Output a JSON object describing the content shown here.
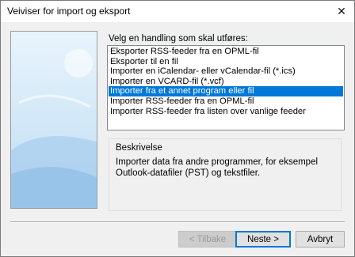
{
  "window": {
    "title": "Veiviser for import og eksport"
  },
  "prompt": "Velg en handling som skal utføres:",
  "actions": [
    {
      "label": "Eksporter RSS-feeder fra en OPML-fil",
      "selected": false
    },
    {
      "label": "Eksporter til en fil",
      "selected": false
    },
    {
      "label": "Importer en iCalendar- eller vCalendar-fil (*.ics)",
      "selected": false
    },
    {
      "label": "Importer en VCARD-fil (*.vcf)",
      "selected": false
    },
    {
      "label": "Importer fra et annet program eller fil",
      "selected": true
    },
    {
      "label": "Importer RSS-feeder fra en OPML-fil",
      "selected": false
    },
    {
      "label": "Importer RSS-feeder fra listen over vanlige feeder",
      "selected": false
    }
  ],
  "description": {
    "title": "Beskrivelse",
    "text": "Importer data fra andre programmer, for eksempel Outlook-datafiler (PST) og tekstfiler."
  },
  "buttons": {
    "back": "< Tilbake",
    "next": "Neste >",
    "cancel": "Avbryt"
  },
  "colors": {
    "selection": "#0078d7",
    "illustration_sky": "#cfe6f7",
    "illustration_ground": "#9fc7e8"
  }
}
